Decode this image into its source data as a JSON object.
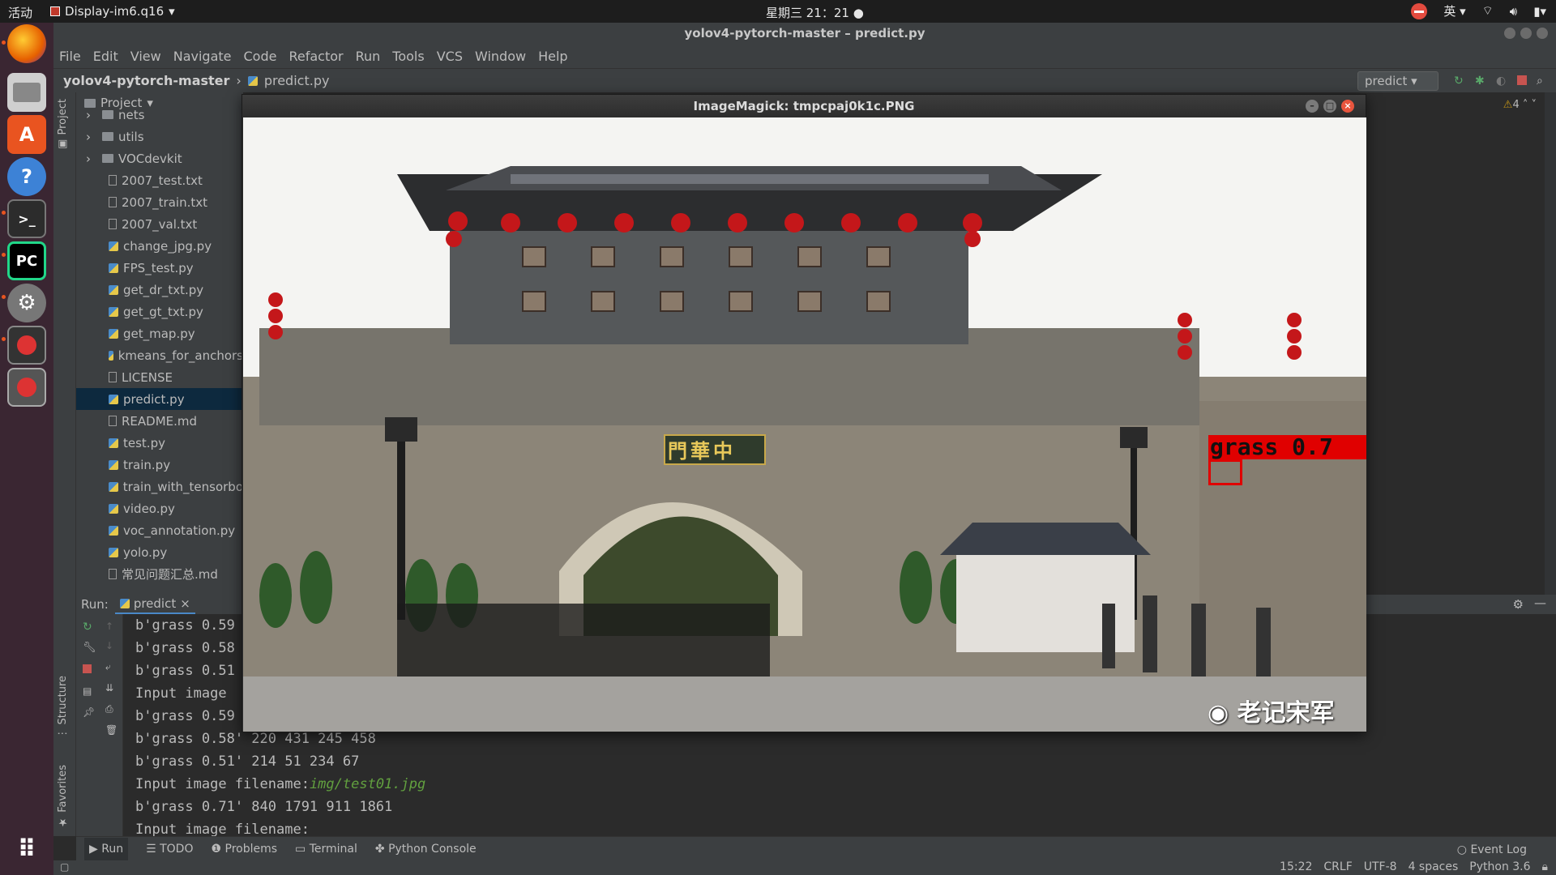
{
  "topbar": {
    "activities": "活动",
    "app_menu": "Display-im6.q16",
    "clock": "星期三 21：21",
    "ime": "英"
  },
  "window": {
    "title": "yolov4-pytorch-master – predict.py"
  },
  "menu": [
    "File",
    "Edit",
    "View",
    "Navigate",
    "Code",
    "Refactor",
    "Run",
    "Tools",
    "VCS",
    "Window",
    "Help"
  ],
  "nav": {
    "project": "yolov4-pytorch-master",
    "file": "predict.py",
    "run_config": "predict"
  },
  "project_panel": {
    "header": "Project",
    "items": [
      {
        "label": "nets",
        "type": "folder"
      },
      {
        "label": "utils",
        "type": "folder"
      },
      {
        "label": "VOCdevkit",
        "type": "folder"
      },
      {
        "label": "2007_test.txt",
        "type": "file"
      },
      {
        "label": "2007_train.txt",
        "type": "file"
      },
      {
        "label": "2007_val.txt",
        "type": "file"
      },
      {
        "label": "change_jpg.py",
        "type": "py"
      },
      {
        "label": "FPS_test.py",
        "type": "py"
      },
      {
        "label": "get_dr_txt.py",
        "type": "py"
      },
      {
        "label": "get_gt_txt.py",
        "type": "py"
      },
      {
        "label": "get_map.py",
        "type": "py"
      },
      {
        "label": "kmeans_for_anchors",
        "type": "py"
      },
      {
        "label": "LICENSE",
        "type": "file"
      },
      {
        "label": "predict.py",
        "type": "py",
        "selected": true
      },
      {
        "label": "README.md",
        "type": "file"
      },
      {
        "label": "test.py",
        "type": "py"
      },
      {
        "label": "train.py",
        "type": "py"
      },
      {
        "label": "train_with_tensorbo",
        "type": "py"
      },
      {
        "label": "video.py",
        "type": "py"
      },
      {
        "label": "voc_annotation.py",
        "type": "py"
      },
      {
        "label": "yolo.py",
        "type": "py"
      },
      {
        "label": "常见问题汇总.md",
        "type": "file"
      }
    ]
  },
  "editor": {
    "warnings": "4"
  },
  "run_panel": {
    "label": "Run:",
    "tab": "predict",
    "console": [
      {
        "text": "b'grass 0.59",
        "kind": "out"
      },
      {
        "text": "b'grass 0.58",
        "kind": "out"
      },
      {
        "text": "b'grass 0.51",
        "kind": "out"
      },
      {
        "text": "Input image",
        "kind": "out"
      },
      {
        "text": "b'grass 0.59",
        "kind": "out"
      },
      {
        "text": "b'grass 0.58' 220 431 245 458",
        "kind": "out"
      },
      {
        "text": "b'grass 0.51' 214 51 234 67",
        "kind": "out"
      },
      {
        "text": "Input image filename:",
        "kind": "prompt",
        "input": "img/test01.jpg"
      },
      {
        "text": "b'grass 0.71' 840 1791 911 1861",
        "kind": "out"
      },
      {
        "text": "Input image filename:",
        "kind": "out"
      }
    ]
  },
  "bottom_tabs": [
    "Run",
    "TODO",
    "Problems",
    "Terminal",
    "Python Console"
  ],
  "event_log": "Event Log",
  "status": {
    "position": "15:22",
    "line_sep": "CRLF",
    "encoding": "UTF-8",
    "indent": "4 spaces",
    "interpreter": "Python 3.6"
  },
  "image_window": {
    "title": "ImageMagick: tmpcpaj0k1c.PNG",
    "detection_label": "grass 0.7",
    "plaque": "門華中",
    "watermark": "老记宋军"
  },
  "colors": {
    "ide_bg": "#2b2b2b",
    "panel_bg": "#3c3f41",
    "dock_bg": "#3a2632",
    "detection": "#e00000",
    "console_input": "#62a03f"
  }
}
